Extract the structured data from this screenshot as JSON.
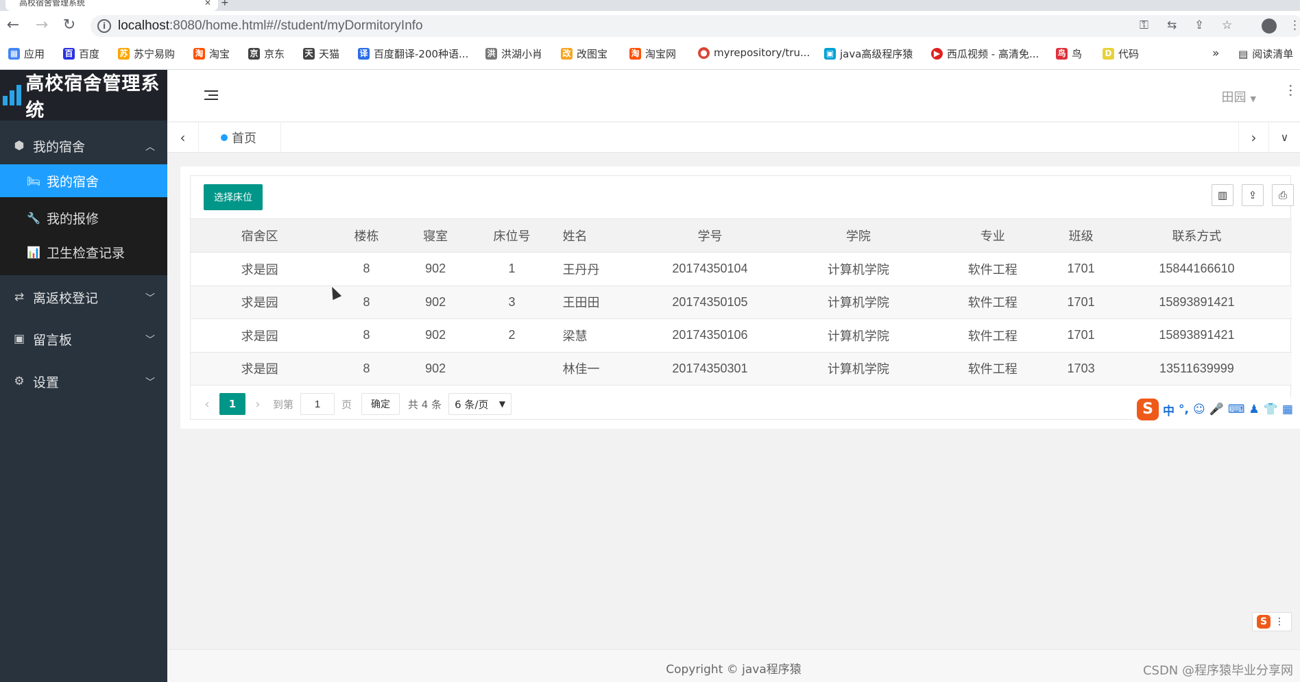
{
  "browser": {
    "tab_title": "高校宿舍管理系统",
    "url_host": "localhost",
    "url_rest": ":8080/home.html#//student/myDormitoryInfo",
    "bookmarks": [
      {
        "label": "应用",
        "color": "#4285f4",
        "glyph": "▦"
      },
      {
        "label": "百度",
        "color": "#2932e1",
        "glyph": "百"
      },
      {
        "label": "苏宁易购",
        "color": "#f9a600",
        "glyph": "苏"
      },
      {
        "label": "淘宝",
        "color": "#ff5000",
        "glyph": "淘"
      },
      {
        "label": "京东",
        "color": "#444444",
        "glyph": "京"
      },
      {
        "label": "天猫",
        "color": "#444444",
        "glyph": "天"
      },
      {
        "label": "百度翻译-200种语...",
        "color": "#2b6de5",
        "glyph": "译"
      },
      {
        "label": "洪湖小肖",
        "color": "#777777",
        "glyph": "洪"
      },
      {
        "label": "改图宝",
        "color": "#f5a623",
        "glyph": "改"
      },
      {
        "label": "淘宝网",
        "color": "#ff5000",
        "glyph": "淘"
      },
      {
        "label": "myrepository/tru...",
        "color": "#db4437",
        "glyph": "●"
      },
      {
        "label": "java高级程序猿",
        "color": "#00a1d6",
        "glyph": "▣"
      },
      {
        "label": "西瓜视频 - 高清免...",
        "color": "#e02020",
        "glyph": "▶"
      },
      {
        "label": "鸟",
        "color": "#e0303b",
        "glyph": "鸟"
      },
      {
        "label": "代码",
        "color": "#e7d23a",
        "glyph": "D"
      }
    ],
    "more_label": "»",
    "reading_list": "阅读清单"
  },
  "app": {
    "title": "高校宿舍管理系统",
    "user_name": "田园",
    "home_tab": "首页",
    "menu": {
      "group_dorm": "我的宿舍",
      "sub_items": [
        {
          "label": "我的宿舍",
          "icon": "bed-icon",
          "active": true
        },
        {
          "label": "我的报修",
          "icon": "wrench-icon",
          "active": false
        },
        {
          "label": "卫生检查记录",
          "icon": "bar-chart-icon",
          "active": false
        }
      ],
      "group_return": "离返校登记",
      "group_message": "留言板",
      "group_settings": "设置"
    },
    "toolbar": {
      "choose_bed": "选择床位"
    },
    "table": {
      "columns": [
        "宿舍区",
        "楼栋",
        "寝室",
        "床位号",
        "姓名",
        "学号",
        "学院",
        "专业",
        "班级",
        "联系方式"
      ],
      "rows": [
        [
          "求是园",
          "8",
          "902",
          "1",
          "王丹丹",
          "20174350104",
          "计算机学院",
          "软件工程",
          "1701",
          "15844166610"
        ],
        [
          "求是园",
          "8",
          "902",
          "3",
          "王田田",
          "20174350105",
          "计算机学院",
          "软件工程",
          "1701",
          "15893891421"
        ],
        [
          "求是园",
          "8",
          "902",
          "2",
          "梁慧",
          "20174350106",
          "计算机学院",
          "软件工程",
          "1701",
          "15893891421"
        ],
        [
          "求是园",
          "8",
          "902",
          "",
          "林佳一",
          "20174350301",
          "计算机学院",
          "软件工程",
          "1703",
          "13511639999"
        ]
      ]
    },
    "pager": {
      "current": "1",
      "goto_label": "到第",
      "goto_value": "1",
      "unit": "页",
      "confirm": "确定",
      "total": "共 4 条",
      "page_size": "6 条/页"
    },
    "footer": {
      "copyright": "Copyright © java程序猿",
      "watermark": "CSDN @程序猿毕业分享网"
    }
  },
  "ime": {
    "logo": "S",
    "mode": "中"
  }
}
